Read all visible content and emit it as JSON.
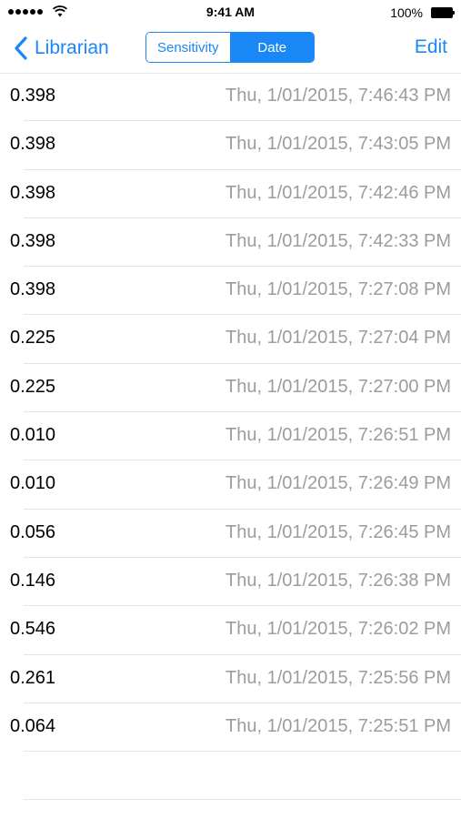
{
  "status_bar": {
    "time": "9:41 AM",
    "battery": "100%"
  },
  "nav": {
    "back_label": "Librarian",
    "segments": [
      "Sensitivity",
      "Date"
    ],
    "selected_segment": "Date",
    "edit_label": "Edit"
  },
  "colors": {
    "accent": "#1a87f7",
    "secondary_text": "#9c9c9c",
    "separator": "#e3e3e3"
  },
  "rows": [
    {
      "value": "0.398",
      "date": "Thu, 1/01/2015, 7:46:43 PM"
    },
    {
      "value": "0.398",
      "date": "Thu, 1/01/2015, 7:43:05 PM"
    },
    {
      "value": "0.398",
      "date": "Thu, 1/01/2015, 7:42:46 PM"
    },
    {
      "value": "0.398",
      "date": "Thu, 1/01/2015, 7:42:33 PM"
    },
    {
      "value": "0.398",
      "date": "Thu, 1/01/2015, 7:27:08 PM"
    },
    {
      "value": "0.225",
      "date": "Thu, 1/01/2015, 7:27:04 PM"
    },
    {
      "value": "0.225",
      "date": "Thu, 1/01/2015, 7:27:00 PM"
    },
    {
      "value": "0.010",
      "date": "Thu, 1/01/2015, 7:26:51 PM"
    },
    {
      "value": "0.010",
      "date": "Thu, 1/01/2015, 7:26:49 PM"
    },
    {
      "value": "0.056",
      "date": "Thu, 1/01/2015, 7:26:45 PM"
    },
    {
      "value": "0.146",
      "date": "Thu, 1/01/2015, 7:26:38 PM"
    },
    {
      "value": "0.546",
      "date": "Thu, 1/01/2015, 7:26:02 PM"
    },
    {
      "value": "0.261",
      "date": "Thu, 1/01/2015, 7:25:56 PM"
    },
    {
      "value": "0.064",
      "date": "Thu, 1/01/2015, 7:25:51 PM"
    }
  ]
}
